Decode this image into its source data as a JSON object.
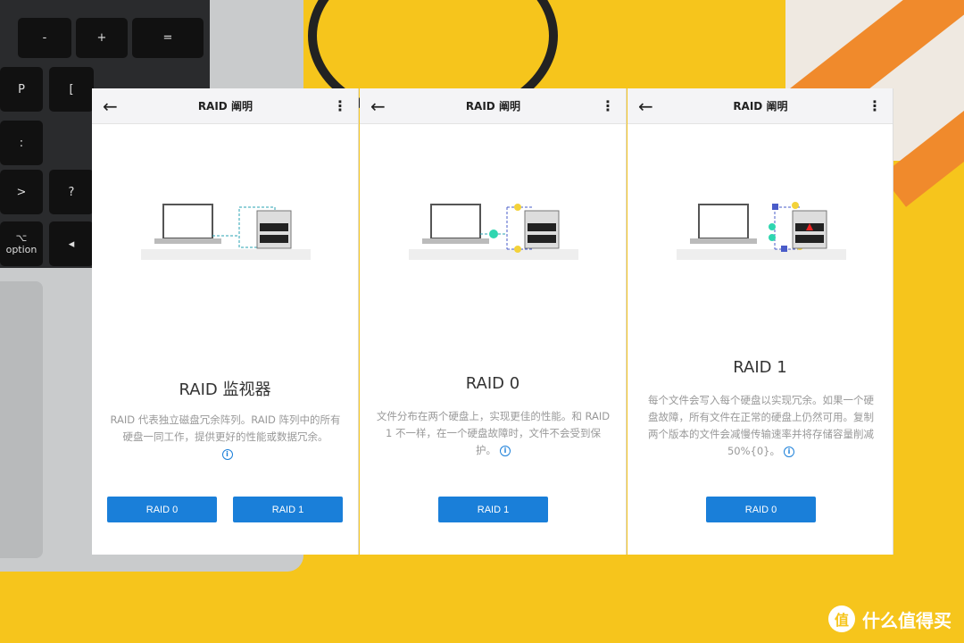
{
  "header_title": "RAID 阐明",
  "panels": [
    {
      "title": "RAID 监视器",
      "desc": "RAID 代表独立磁盘冗余阵列。RAID 阵列中的所有硬盘一同工作，提供更好的性能或数据冗余。",
      "buttons": [
        "RAID 0",
        "RAID 1"
      ]
    },
    {
      "title": "RAID 0",
      "desc": "文件分布在两个硬盘上，实现更佳的性能。和 RAID 1 不一样，在一个硬盘故障时，文件不会受到保护。",
      "buttons": [
        "RAID 1"
      ]
    },
    {
      "title": "RAID 1",
      "desc": "每个文件会写入每个硬盘以实现冗余。如果一个硬盘故障，所有文件在正常的硬盘上仍然可用。复制两个版本的文件会减慢传输速率并将存储容量削减 50%{0}。",
      "buttons": [
        "RAID 0"
      ]
    }
  ],
  "keyboard": {
    "keys": [
      "-",
      "+",
      "=",
      "P",
      "[",
      "{",
      "}",
      ":",
      ";",
      "\"",
      "'",
      ">",
      "?",
      "/",
      "⌥",
      "option",
      "◂"
    ]
  },
  "watermark": "什么值得买",
  "colors": {
    "accent": "#1a7fd9",
    "background": "#f6c51c"
  }
}
